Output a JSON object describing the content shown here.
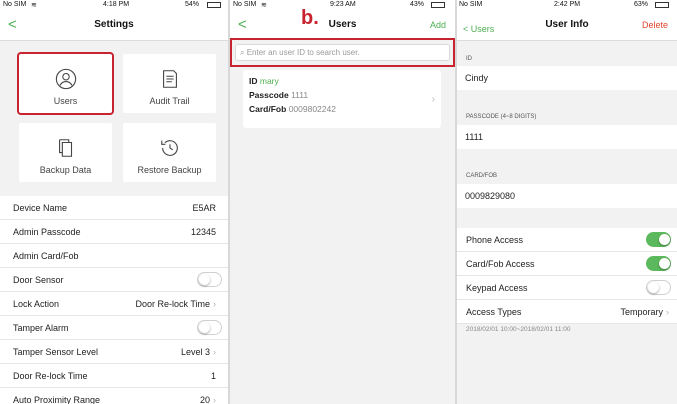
{
  "panel1": {
    "status": {
      "carrier": "No SIM",
      "wifi_icon": "wifi-icon",
      "time": "4:18 PM",
      "battery": "54%"
    },
    "nav": {
      "back": "<",
      "title": "Settings"
    },
    "tiles": {
      "users": "Users",
      "audit_trail": "Audit Trail",
      "backup_data": "Backup Data",
      "restore_backup": "Restore Backup"
    },
    "rows": {
      "device_name": {
        "label": "Device Name",
        "value": "E5AR"
      },
      "admin_passcode": {
        "label": "Admin Passcode",
        "value": "12345"
      },
      "admin_card": {
        "label": "Admin Card/Fob"
      },
      "door_sensor": {
        "label": "Door Sensor",
        "on": false
      },
      "lock_action": {
        "label": "Lock Action",
        "value": "Door Re-lock Time"
      },
      "tamper_alarm": {
        "label": "Tamper Alarm",
        "on": false
      },
      "tamper_level": {
        "label": "Tamper Sensor Level",
        "value": "Level 3"
      },
      "relock_time": {
        "label": "Door Re-lock Time",
        "value": "1"
      },
      "auto_proximity": {
        "label": "Auto Proximity Range",
        "value": "20"
      }
    }
  },
  "panel2": {
    "status": {
      "carrier": "No SIM",
      "time": "9:23 AM",
      "battery": "43%"
    },
    "annotation": "b.",
    "nav": {
      "back": "<",
      "title": "Users",
      "add": "Add"
    },
    "search": {
      "placeholder": "Enter an user ID to search user."
    },
    "user": {
      "id_label": "ID",
      "id_value": "mary",
      "passcode_label": "Passcode",
      "passcode_value": "1111",
      "card_label": "Card/Fob",
      "card_value": "0009802242"
    }
  },
  "panel3": {
    "status": {
      "carrier": "No SIM",
      "time": "2:42 PM",
      "battery": "63%"
    },
    "nav": {
      "back": "< Users",
      "title": "User Info",
      "delete": "Delete"
    },
    "id": {
      "header": "ID",
      "value": "Cindy"
    },
    "passcode": {
      "header": "PASSCODE (4~8 DIGITS)",
      "value": "1111"
    },
    "card": {
      "header": "CARD/FOB",
      "value": "0009829080"
    },
    "access": {
      "phone": {
        "label": "Phone Access",
        "on": true
      },
      "card": {
        "label": "Card/Fob Access",
        "on": true
      },
      "keypad": {
        "label": "Keypad Access",
        "on": false
      },
      "types": {
        "label": "Access Types",
        "value": "Temporary"
      }
    },
    "dates": "2018/02/01 10:00~2018/02/01 11:00"
  },
  "colors": {
    "accent": "#4caf50",
    "highlight": "#c8242f",
    "delete": "#e2452c"
  }
}
